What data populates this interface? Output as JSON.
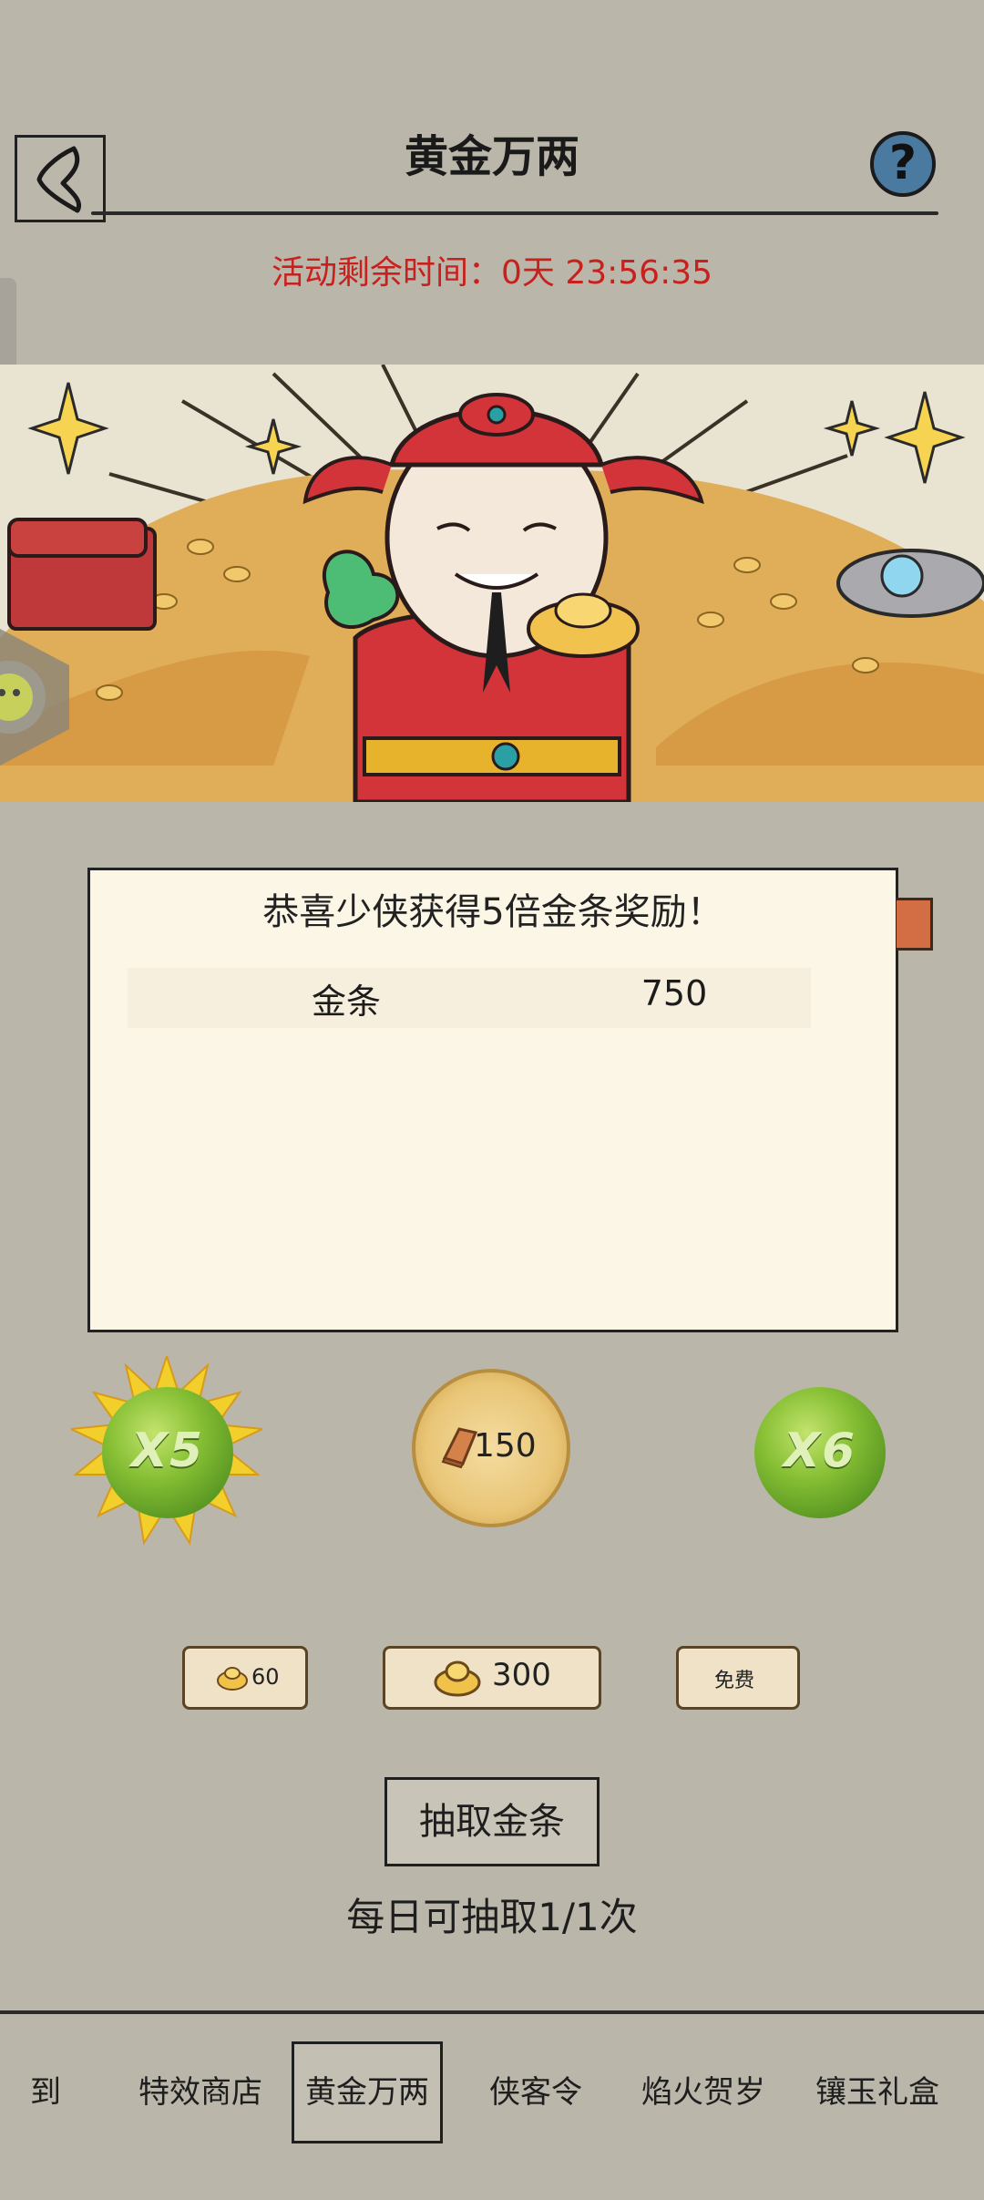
{
  "header": {
    "title": "黄金万两",
    "help_glyph": "?",
    "back_icon": "back-arrow-icon"
  },
  "timer": {
    "text": "活动剩余时间：0天 23:56:35"
  },
  "result_panel": {
    "title": "恭喜少侠获得5倍金条奖励！",
    "rows": [
      {
        "name": "金条",
        "value": "750"
      }
    ]
  },
  "multipliers": {
    "left": "X5",
    "right": "X6"
  },
  "coin_cost": "150",
  "price_tags": {
    "tag_60": "60",
    "tag_300": "300",
    "tag_free": "免费"
  },
  "draw_button": "抽取金条",
  "daily_limit": "每日可抽取1/1次",
  "bottom_nav": [
    {
      "label": "到"
    },
    {
      "label": "特效商店"
    },
    {
      "label": "黄金万两"
    },
    {
      "label": "侠客令"
    },
    {
      "label": "焰火贺岁"
    },
    {
      "label": "镶玉礼盒"
    }
  ],
  "colors": {
    "background": "#bbb6aa",
    "timer_red": "#c8201d",
    "panel_bg": "#fcf6e7",
    "gold": "#e9c678",
    "green_orb": "#86bf34"
  }
}
